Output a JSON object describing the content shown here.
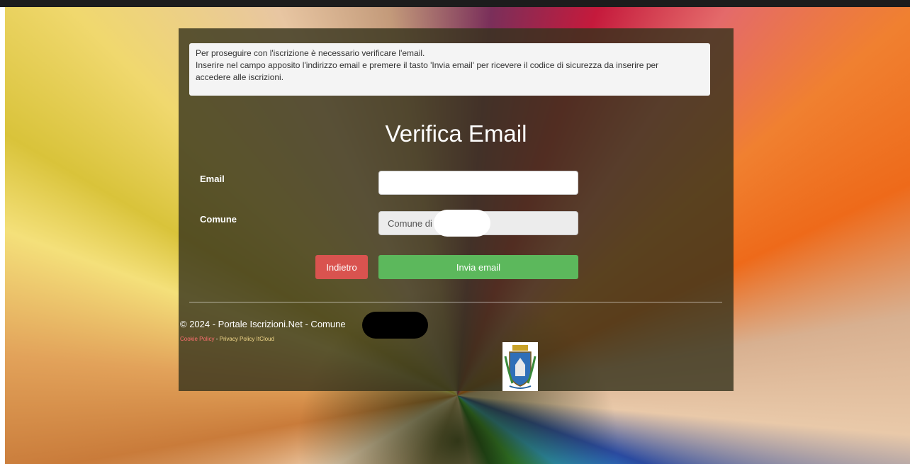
{
  "notice": {
    "line1": "Per proseguire con l'iscrizione è necessario verificare l'email.",
    "line2": "Inserire nel campo apposito l'indirizzo email e premere il tasto 'Invia email' per ricevere il codice di sicurezza da inserire per",
    "line3": "accedere alle iscrizioni."
  },
  "form": {
    "title": "Verifica Email",
    "email_label": "Email",
    "email_value": "",
    "comune_label": "Comune",
    "comune_value": "Comune di",
    "back_label": "Indietro",
    "send_label": "Invia email"
  },
  "footer": {
    "copyright": "© 2024 - Portale Iscrizioni.Net - Comune",
    "cookie_link": "Cookie Policy",
    "separator": "-",
    "privacy_link": "Privacy Policy ItCloud"
  },
  "colors": {
    "back_button": "#d9534f",
    "send_button": "#5cb85c",
    "panel": "#34321c"
  },
  "icons": {
    "crest": "municipal-coat-of-arms"
  }
}
